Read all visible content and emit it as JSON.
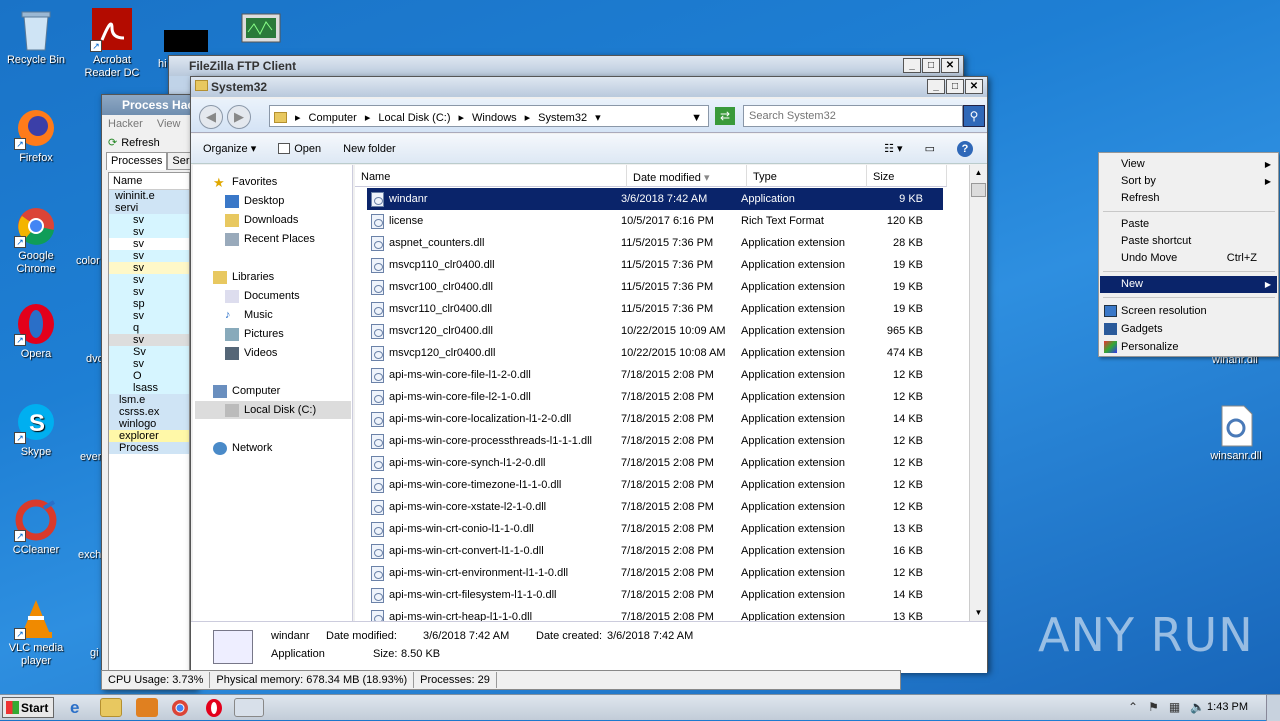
{
  "desktop": {
    "icons": [
      {
        "label": "Recycle Bin",
        "icon": "recycle-bin-icon"
      },
      {
        "label": "Acrobat Reader DC",
        "icon": "acrobat-icon"
      },
      {
        "label": "Firefox",
        "icon": "firefox-icon"
      },
      {
        "label": "Google Chrome",
        "icon": "chrome-icon"
      },
      {
        "label": "Opera",
        "icon": "opera-icon"
      },
      {
        "label": "Skype",
        "icon": "skype-icon"
      },
      {
        "label": "CCleaner",
        "icon": "ccleaner-icon"
      },
      {
        "label": "VLC media player",
        "icon": "vlc-icon"
      },
      {
        "label": "winsanr.dll",
        "icon": "dll-icon"
      }
    ],
    "partial_labels": [
      "hi",
      "FileZ",
      "color",
      "dvd",
      "ever",
      "exch",
      "gi",
      "winanr.dll"
    ]
  },
  "filezilla": {
    "title": "FileZilla FTP Client"
  },
  "process_hacker": {
    "title": "Process Hac",
    "menu": [
      "Hacker",
      "View"
    ],
    "refresh": "Refresh",
    "tabs": [
      "Processes",
      "Ser"
    ],
    "col_name": "Name",
    "rows": [
      "wininit.e",
      "servi",
      "sv",
      "sv",
      "sv",
      "sv",
      "sv",
      "sv",
      "sv",
      "sp",
      "sv",
      "q",
      "sv",
      "Sv",
      "sv",
      "O",
      "lsass",
      "lsm.e",
      "csrss.ex",
      "winlogo",
      "explorer",
      "Process"
    ]
  },
  "explorer": {
    "title": "System32",
    "breadcrumb": [
      "Computer",
      "Local Disk (C:)",
      "Windows",
      "System32"
    ],
    "search_placeholder": "Search System32",
    "toolbar": {
      "organize": "Organize",
      "open": "Open",
      "new_folder": "New folder"
    },
    "nav": {
      "favorites": "Favorites",
      "desktop": "Desktop",
      "downloads": "Downloads",
      "recent": "Recent Places",
      "libraries": "Libraries",
      "documents": "Documents",
      "music": "Music",
      "pictures": "Pictures",
      "videos": "Videos",
      "computer": "Computer",
      "localdisk": "Local Disk (C:)",
      "network": "Network"
    },
    "columns": {
      "name": "Name",
      "date": "Date modified",
      "type": "Type",
      "size": "Size"
    },
    "files": [
      {
        "name": "windanr",
        "date": "3/6/2018 7:42 AM",
        "type": "Application",
        "size": "9 KB"
      },
      {
        "name": "license",
        "date": "10/5/2017 6:16 PM",
        "type": "Rich Text Format",
        "size": "120 KB"
      },
      {
        "name": "aspnet_counters.dll",
        "date": "11/5/2015 7:36 PM",
        "type": "Application extension",
        "size": "28 KB"
      },
      {
        "name": "msvcp110_clr0400.dll",
        "date": "11/5/2015 7:36 PM",
        "type": "Application extension",
        "size": "19 KB"
      },
      {
        "name": "msvcr100_clr0400.dll",
        "date": "11/5/2015 7:36 PM",
        "type": "Application extension",
        "size": "19 KB"
      },
      {
        "name": "msvcr110_clr0400.dll",
        "date": "11/5/2015 7:36 PM",
        "type": "Application extension",
        "size": "19 KB"
      },
      {
        "name": "msvcr120_clr0400.dll",
        "date": "10/22/2015 10:09 AM",
        "type": "Application extension",
        "size": "965 KB"
      },
      {
        "name": "msvcp120_clr0400.dll",
        "date": "10/22/2015 10:08 AM",
        "type": "Application extension",
        "size": "474 KB"
      },
      {
        "name": "api-ms-win-core-file-l1-2-0.dll",
        "date": "7/18/2015 2:08 PM",
        "type": "Application extension",
        "size": "12 KB"
      },
      {
        "name": "api-ms-win-core-file-l2-1-0.dll",
        "date": "7/18/2015 2:08 PM",
        "type": "Application extension",
        "size": "12 KB"
      },
      {
        "name": "api-ms-win-core-localization-l1-2-0.dll",
        "date": "7/18/2015 2:08 PM",
        "type": "Application extension",
        "size": "14 KB"
      },
      {
        "name": "api-ms-win-core-processthreads-l1-1-1.dll",
        "date": "7/18/2015 2:08 PM",
        "type": "Application extension",
        "size": "12 KB"
      },
      {
        "name": "api-ms-win-core-synch-l1-2-0.dll",
        "date": "7/18/2015 2:08 PM",
        "type": "Application extension",
        "size": "12 KB"
      },
      {
        "name": "api-ms-win-core-timezone-l1-1-0.dll",
        "date": "7/18/2015 2:08 PM",
        "type": "Application extension",
        "size": "12 KB"
      },
      {
        "name": "api-ms-win-core-xstate-l2-1-0.dll",
        "date": "7/18/2015 2:08 PM",
        "type": "Application extension",
        "size": "12 KB"
      },
      {
        "name": "api-ms-win-crt-conio-l1-1-0.dll",
        "date": "7/18/2015 2:08 PM",
        "type": "Application extension",
        "size": "13 KB"
      },
      {
        "name": "api-ms-win-crt-convert-l1-1-0.dll",
        "date": "7/18/2015 2:08 PM",
        "type": "Application extension",
        "size": "16 KB"
      },
      {
        "name": "api-ms-win-crt-environment-l1-1-0.dll",
        "date": "7/18/2015 2:08 PM",
        "type": "Application extension",
        "size": "12 KB"
      },
      {
        "name": "api-ms-win-crt-filesystem-l1-1-0.dll",
        "date": "7/18/2015 2:08 PM",
        "type": "Application extension",
        "size": "14 KB"
      },
      {
        "name": "api-ms-win-crt-heap-l1-1-0.dll",
        "date": "7/18/2015 2:08 PM",
        "type": "Application extension",
        "size": "13 KB"
      }
    ],
    "details": {
      "name": "windanr",
      "type": "Application",
      "modified_label": "Date modified:",
      "modified": "3/6/2018 7:42 AM",
      "created_label": "Date created:",
      "created": "3/6/2018 7:42 AM",
      "size_label": "Size:",
      "size": "8.50 KB"
    }
  },
  "statusbar": {
    "cpu": "CPU Usage: 3.73%",
    "memory": "Physical memory: 678.34 MB (18.93%)",
    "processes": "Processes: 29"
  },
  "context_menu": {
    "view": "View",
    "sort_by": "Sort by",
    "refresh": "Refresh",
    "paste": "Paste",
    "paste_shortcut": "Paste shortcut",
    "undo_move": "Undo Move",
    "undo_shortcut": "Ctrl+Z",
    "new": "New",
    "screen_resolution": "Screen resolution",
    "gadgets": "Gadgets",
    "personalize": "Personalize"
  },
  "taskbar": {
    "start": "Start",
    "time": "1:43 PM"
  },
  "watermark": "ANY RUN"
}
